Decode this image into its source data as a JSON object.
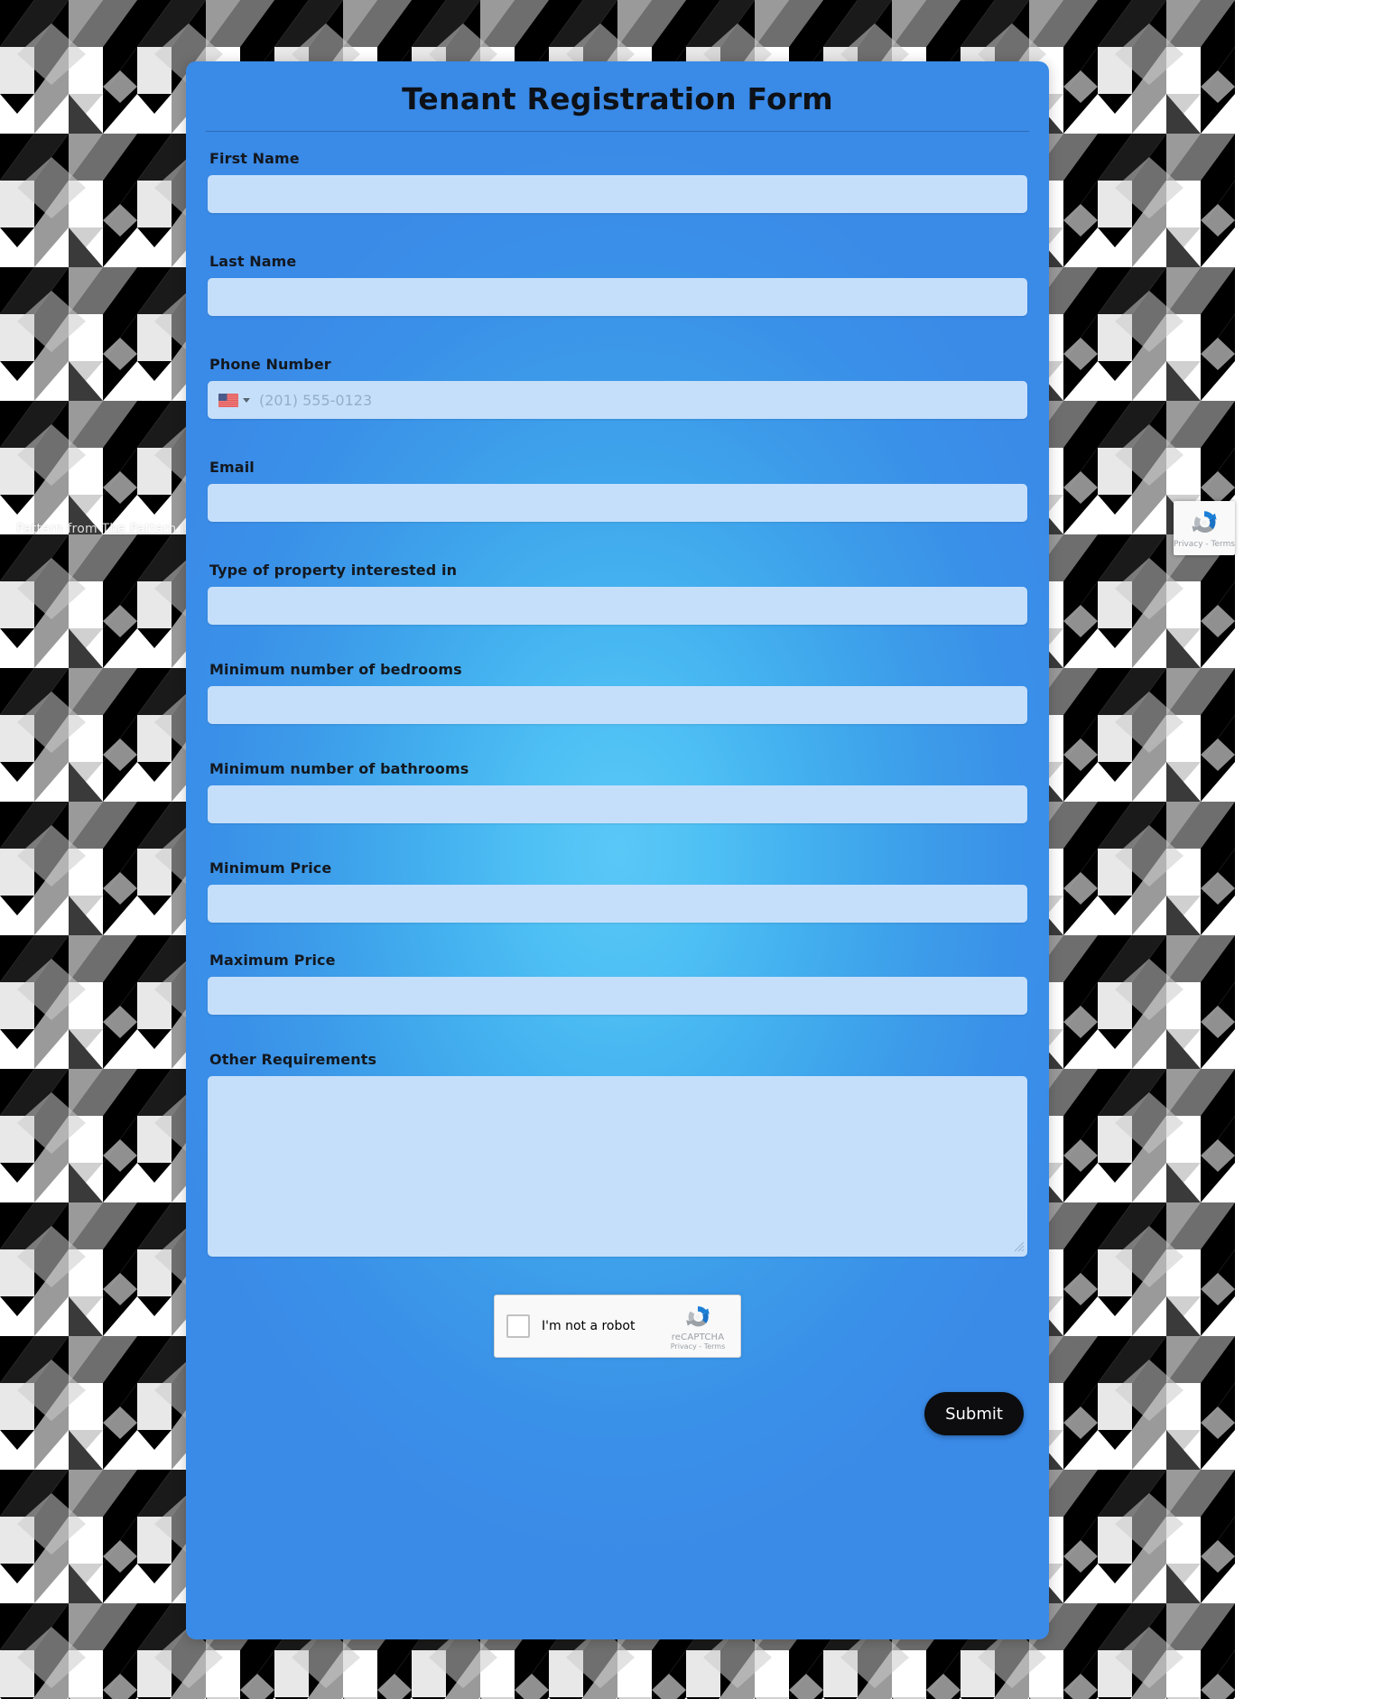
{
  "background": {
    "credit_prefix": "Pattern from ",
    "credit_link": "The Pattern Library",
    "pattern_name": "geometric-diamond-chevron",
    "colors": [
      "#000000",
      "#ffffff",
      "#808080",
      "#d9d9d9",
      "#404040"
    ]
  },
  "card": {
    "title": "Tenant Registration Form",
    "accent_color": "#3a8ee6",
    "center_color": "#5ac8f7",
    "input_color": "#c5dffb"
  },
  "fields": [
    {
      "label": "First Name",
      "value": "",
      "placeholder": "",
      "type": "text",
      "name": "first-name"
    },
    {
      "label": "Last Name",
      "value": "",
      "placeholder": "",
      "type": "text",
      "name": "last-name"
    },
    {
      "label": "Phone Number",
      "value": "",
      "placeholder": "(201) 555-0123",
      "type": "tel",
      "name": "phone-number",
      "country": "US",
      "country_flag": "us-flag-icon"
    },
    {
      "label": "Email",
      "value": "",
      "placeholder": "",
      "type": "email",
      "name": "email"
    },
    {
      "label": "Type of property interested in",
      "value": "",
      "placeholder": "",
      "type": "text",
      "name": "property-type"
    },
    {
      "label": "Minimum number of bedrooms",
      "value": "",
      "placeholder": "",
      "type": "text",
      "name": "min-bedrooms"
    },
    {
      "label": "Minimum number of bathrooms",
      "value": "",
      "placeholder": "",
      "type": "text",
      "name": "min-bathrooms"
    },
    {
      "label": "Minimum Price",
      "value": "",
      "placeholder": "",
      "type": "text",
      "name": "min-price"
    },
    {
      "label": "Maximum Price",
      "value": "",
      "placeholder": "",
      "type": "text",
      "name": "max-price"
    },
    {
      "label": "Other Requirements",
      "value": "",
      "placeholder": "",
      "type": "textarea",
      "name": "other-requirements"
    }
  ],
  "recaptcha": {
    "checkbox_label": "I'm not a robot",
    "brand": "reCAPTCHA",
    "legal": "Privacy - Terms",
    "checked": false,
    "logo_icon": "recaptcha-logo-icon"
  },
  "recaptcha_badge": {
    "legal": "Privacy - Terms",
    "logo_icon": "recaptcha-logo-icon"
  },
  "submit": {
    "label": "Submit",
    "background": "#0d0d0f",
    "text_color": "#ffffff"
  }
}
